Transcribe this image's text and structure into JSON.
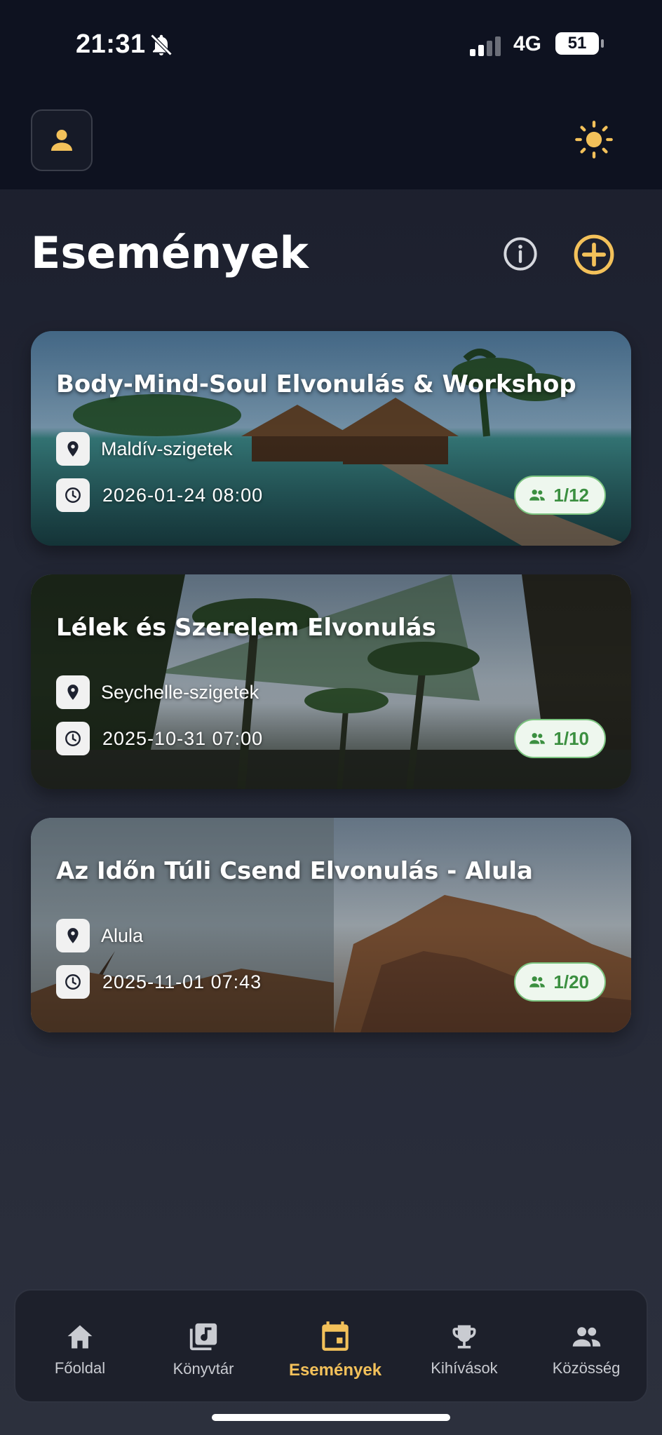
{
  "status_bar": {
    "time": "21:31",
    "network": "4G",
    "battery": "51",
    "icons": [
      "bell-slash-icon",
      "signal-icon"
    ]
  },
  "header": {
    "profile_icon": "person-icon",
    "theme_icon": "sun-icon"
  },
  "page": {
    "title": "Események",
    "info_icon": "info-icon",
    "add_icon": "plus-circle-icon",
    "accent_color": "#f3c15a"
  },
  "events": [
    {
      "title": "Body-Mind-Soul Elvonulás & Workshop",
      "location": "Maldív-szigetek",
      "datetime": "2026-01-24 08:00",
      "participants": "1/12"
    },
    {
      "title": "Lélek és Szerelem Elvonulás",
      "location": "Seychelle-szigetek",
      "datetime": "2025-10-31 07:00",
      "participants": "1/10"
    },
    {
      "title": "Az Időn Túli Csend Elvonulás - Alula",
      "location": "Alula",
      "datetime": "2025-11-01 07:43",
      "participants": "1/20"
    }
  ],
  "nav": {
    "items": [
      {
        "label": "Főoldal",
        "icon": "home-icon"
      },
      {
        "label": "Könyvtár",
        "icon": "music-library-icon"
      },
      {
        "label": "Események",
        "icon": "calendar-icon",
        "active": true
      },
      {
        "label": "Kihívások",
        "icon": "trophy-icon"
      },
      {
        "label": "Közösség",
        "icon": "people-icon"
      }
    ]
  },
  "colors": {
    "badge_green": "#3b8f40",
    "badge_bg": "#eef7ee",
    "background": "#222634"
  }
}
